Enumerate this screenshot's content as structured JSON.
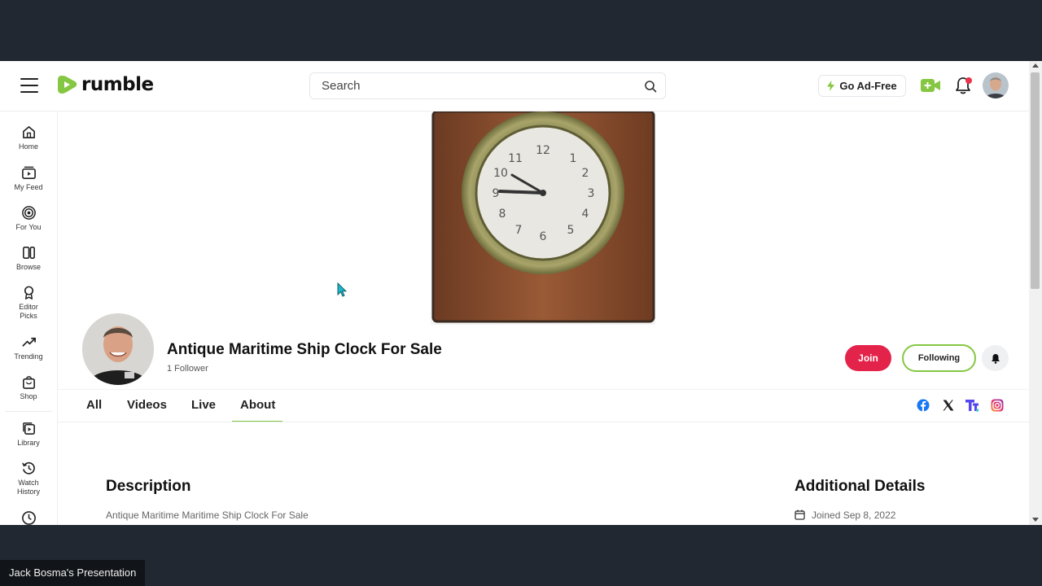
{
  "header": {
    "logo_text": "rumble",
    "search_placeholder": "Search",
    "go_ad_free": "Go Ad-Free"
  },
  "sidebar": {
    "items": [
      {
        "label": "Home",
        "icon": "home-icon"
      },
      {
        "label": "My Feed",
        "icon": "feed-icon"
      },
      {
        "label": "For You",
        "icon": "target-icon"
      },
      {
        "label": "Browse",
        "icon": "browse-icon"
      },
      {
        "label": "Editor Picks",
        "icon": "award-icon"
      },
      {
        "label": "Trending",
        "icon": "trending-icon"
      },
      {
        "label": "Shop",
        "icon": "shop-icon"
      },
      {
        "label": "Library",
        "icon": "library-icon"
      },
      {
        "label": "Watch History",
        "icon": "history-icon"
      }
    ]
  },
  "channel": {
    "title": "Antique Maritime Ship Clock For Sale",
    "followers": "1 Follower",
    "join_label": "Join",
    "following_label": "Following"
  },
  "tabs": [
    "All",
    "Videos",
    "Live",
    "About"
  ],
  "active_tab": "About",
  "about": {
    "description_heading": "Description",
    "description_text": "Antique Maritime Maritime Ship Clock For Sale",
    "details_heading": "Additional Details",
    "joined": "Joined Sep 8, 2022"
  },
  "presentation_label": "Jack Bosma's Presentation",
  "colors": {
    "brand_green": "#85c742",
    "join_red": "#e3234a",
    "frame_dark": "#222831"
  }
}
